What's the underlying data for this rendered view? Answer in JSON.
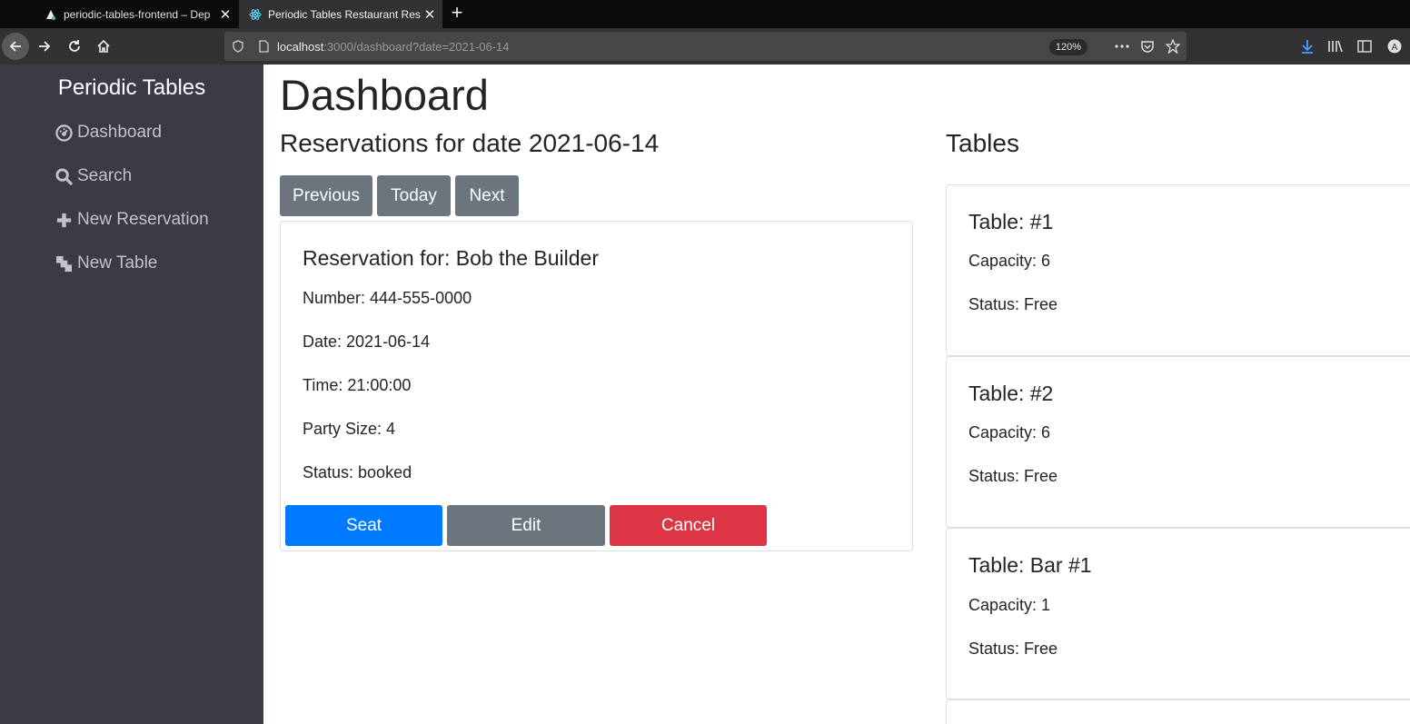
{
  "browser": {
    "tabs": [
      {
        "title": "periodic-tables-frontend – Dep",
        "active": false
      },
      {
        "title": "Periodic Tables Restaurant Rese",
        "active": true
      }
    ],
    "url_host": "localhost",
    "url_rest": ":3000/dashboard?date=2021-06-14",
    "zoom": "120%"
  },
  "sidebar": {
    "brand": "Periodic Tables",
    "items": [
      {
        "label": "Dashboard",
        "icon": "dashboard-icon"
      },
      {
        "label": "Search",
        "icon": "search-icon"
      },
      {
        "label": "New Reservation",
        "icon": "plus-icon"
      },
      {
        "label": "New Table",
        "icon": "layers-icon"
      }
    ]
  },
  "main": {
    "title": "Dashboard",
    "reservations_heading": "Reservations for date 2021-06-14",
    "tables_heading": "Tables",
    "date_nav": {
      "previous": "Previous",
      "today": "Today",
      "next": "Next"
    },
    "reservation": {
      "title": "Reservation for: Bob the Builder",
      "number": "Number: 444-555-0000",
      "date": "Date: 2021-06-14",
      "time": "Time: 21:00:00",
      "party_size": "Party Size: 4",
      "status": "Status: booked",
      "actions": {
        "seat": "Seat",
        "edit": "Edit",
        "cancel": "Cancel"
      }
    },
    "tables": [
      {
        "title": "Table: #1",
        "capacity": "Capacity: 6",
        "status": "Status: Free"
      },
      {
        "title": "Table: #2",
        "capacity": "Capacity: 6",
        "status": "Status: Free"
      },
      {
        "title": "Table: Bar #1",
        "capacity": "Capacity: 1",
        "status": "Status: Free"
      }
    ]
  },
  "colors": {
    "sidebar_bg": "#3a3b45",
    "primary": "#007bff",
    "secondary": "#6c757d",
    "danger": "#dc3545"
  }
}
